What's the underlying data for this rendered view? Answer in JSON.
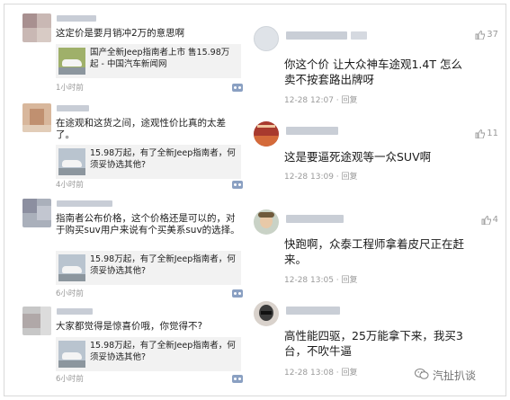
{
  "left_posts": [
    {
      "text": "这定价是要月销冲2万的意思啊",
      "card": "国产全新Jeep指南者上市 售15.98万起 - 中国汽车新闻网",
      "time": "1小时前"
    },
    {
      "text": "在途观和这货之间，途观性价比真的太差了。",
      "card": "15.98万起，有了全新Jeep指南者，何须妥协选其他?",
      "time": "4小时前"
    },
    {
      "text": "指南者公布价格，这个价格还是可以的，对于购买suv用户来说有个买美系suv的选择。",
      "card": "15.98万起，有了全新Jeep指南者，何须妥协选其他?",
      "time": "6小时前"
    },
    {
      "text": "大家都觉得是惊喜价哦，你觉得不?",
      "card": "15.98万起，有了全新Jeep指南者，何须妥协选其他?",
      "time": "6小时前"
    }
  ],
  "right_posts": [
    {
      "text": "你这个价 让大众神车途观1.4T 怎么卖不按套路出牌呀",
      "time": "12-28 12:07 · 回复",
      "likes": "37"
    },
    {
      "text": "这是要逼死途观等一众SUV啊",
      "time": "12-28 13:09 · 回复",
      "likes": "11"
    },
    {
      "text": "快跑啊，众泰工程师拿着皮尺正在赶来。",
      "time": "12-28 13:05 · 回复",
      "likes": "4"
    },
    {
      "text": "高性能四驱，25万能拿下来，我买3台，不吹牛逼",
      "time": "12-28 13:08 · 回复",
      "likes": ""
    }
  ],
  "watermark": {
    "text": "汽扯扒谈",
    "icon": "wechat-icon"
  },
  "colors": {
    "link_blue": "#8aa0c2",
    "time_gray": "#9a9a9a",
    "card_bg": "#f2f2f2"
  }
}
